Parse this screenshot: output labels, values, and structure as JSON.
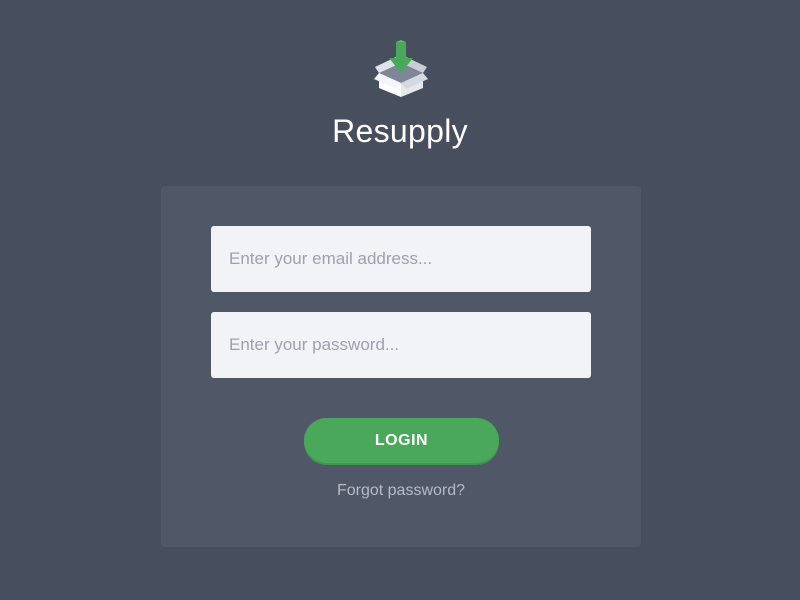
{
  "brand": {
    "name": "Resupply",
    "logo_icon": "box-download-icon"
  },
  "login_form": {
    "email_placeholder": "Enter your email address...",
    "password_placeholder": "Enter your password...",
    "login_label": "LOGIN",
    "forgot_label": "Forgot password?"
  },
  "colors": {
    "background": "#474f5e",
    "card": "#505867",
    "accent": "#4aa85a",
    "input_bg": "#f2f3f7"
  }
}
